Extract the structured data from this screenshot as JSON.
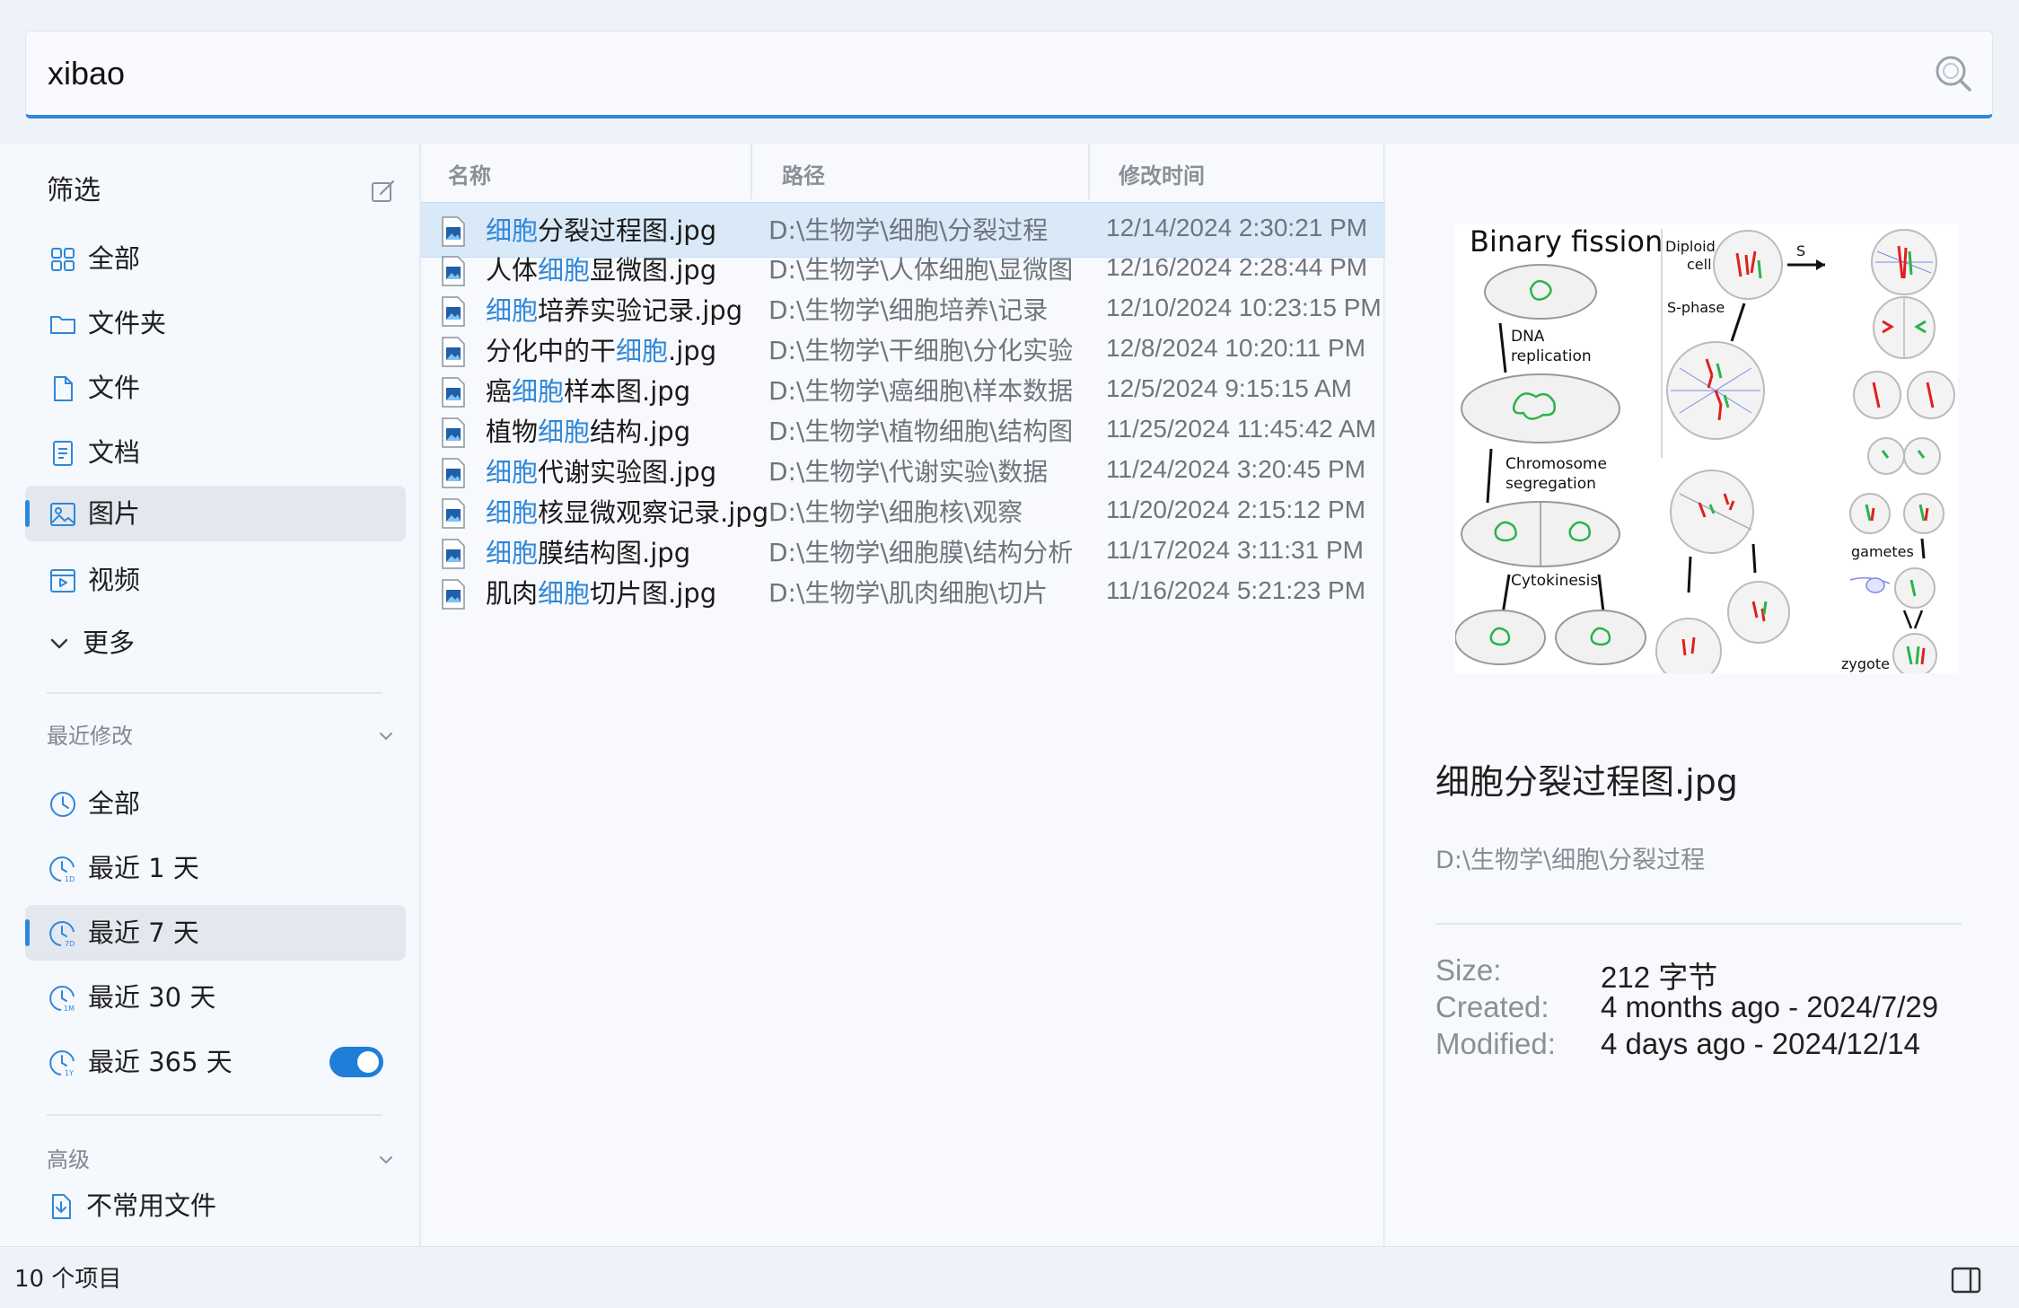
{
  "search": {
    "query": "xibao"
  },
  "sidebar": {
    "filter_title": "筛选",
    "types": [
      {
        "label": "全部",
        "icon": "grid-icon"
      },
      {
        "label": "文件夹",
        "icon": "folder-icon"
      },
      {
        "label": "文件",
        "icon": "file-icon"
      },
      {
        "label": "文档",
        "icon": "document-icon"
      },
      {
        "label": "图片",
        "icon": "image-icon",
        "active": true
      },
      {
        "label": "视频",
        "icon": "video-icon"
      },
      {
        "label": "更多",
        "icon": "chevron-down-icon"
      }
    ],
    "recent_title": "最近修改",
    "recent": [
      {
        "label": "全部"
      },
      {
        "label": "最近 1 天",
        "badge": "1D"
      },
      {
        "label": "最近 7 天",
        "badge": "7D",
        "active": true
      },
      {
        "label": "最近 30 天",
        "badge": "1M"
      },
      {
        "label": "最近 365 天",
        "badge": "1Y"
      }
    ],
    "advanced_title": "高级",
    "advanced_item": {
      "label": "不常用文件",
      "enabled": true
    }
  },
  "list": {
    "columns": [
      "名称",
      "路径",
      "修改时间"
    ],
    "rows": [
      {
        "pre": "",
        "hl": "细胞",
        "post": "分裂过程图.jpg",
        "path": "D:\\生物学\\细胞\\分裂过程",
        "date": "12/14/2024 2:30:21 PM",
        "selected": true
      },
      {
        "pre": "人体",
        "hl": "细胞",
        "post": "显微图.jpg",
        "path": "D:\\生物学\\人体细胞\\显微图",
        "date": "12/16/2024 2:28:44 PM"
      },
      {
        "pre": "",
        "hl": "细胞",
        "post": "培养实验记录.jpg",
        "path": "D:\\生物学\\细胞培养\\记录",
        "date": "12/10/2024 10:23:15 PM"
      },
      {
        "pre": "分化中的干",
        "hl": "细胞",
        "post": ".jpg",
        "path": "D:\\生物学\\干细胞\\分化实验",
        "date": "12/8/2024 10:20:11 PM"
      },
      {
        "pre": "癌",
        "hl": "细胞",
        "post": "样本图.jpg",
        "path": "D:\\生物学\\癌细胞\\样本数据",
        "date": "12/5/2024 9:15:15 AM"
      },
      {
        "pre": "植物",
        "hl": "细胞",
        "post": "结构.jpg",
        "path": "D:\\生物学\\植物细胞\\结构图",
        "date": "11/25/2024 11:45:42 AM"
      },
      {
        "pre": "",
        "hl": "细胞",
        "post": "代谢实验图.jpg",
        "path": "D:\\生物学\\代谢实验\\数据",
        "date": "11/24/2024 3:20:45 PM"
      },
      {
        "pre": "",
        "hl": "细胞",
        "post": "核显微观察记录.jpg",
        "path": "D:\\生物学\\细胞核\\观察",
        "date": "11/20/2024 2:15:12 PM"
      },
      {
        "pre": "",
        "hl": "细胞",
        "post": "膜结构图.jpg",
        "path": "D:\\生物学\\细胞膜\\结构分析",
        "date": "11/17/2024 3:11:31 PM"
      },
      {
        "pre": "肌肉",
        "hl": "细胞",
        "post": "切片图.jpg",
        "path": "D:\\生物学\\肌肉细胞\\切片",
        "date": "11/16/2024 5:21:23 PM"
      }
    ]
  },
  "preview": {
    "image_labels": {
      "title": "Binary fission",
      "dna": [
        "DNA",
        "replication"
      ],
      "chromo": [
        "Chromosome",
        "segregation"
      ],
      "cytokinesis": "Cytokinesis",
      "diploid": [
        "Diploid",
        "cell"
      ],
      "s": "S",
      "sphase": "S-phase",
      "gametes": "gametes",
      "zygote": "zygote"
    },
    "name": "细胞分裂过程图.jpg",
    "path": "D:\\生物学\\细胞\\分裂过程",
    "meta": [
      {
        "key": "Size:",
        "value": "212 字节"
      },
      {
        "key": "Created:",
        "value": "4 months ago - 2024/7/29"
      },
      {
        "key": "Modified:",
        "value": "4 days ago - 2024/12/14"
      }
    ]
  },
  "status": {
    "count": "10 个项目"
  },
  "colors": {
    "accent": "#2f87d9",
    "highlight": "#2f87d9",
    "selected_row": "#d9e9f8"
  }
}
